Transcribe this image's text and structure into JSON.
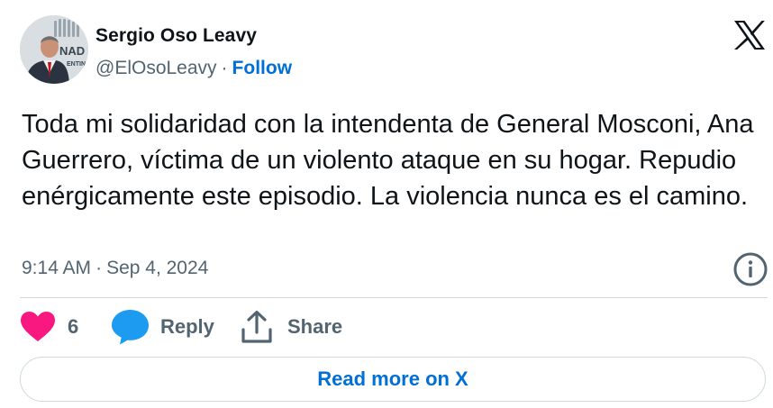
{
  "author": {
    "display_name": "Sergio Oso Leavy",
    "handle": "@ElOsoLeavy",
    "follow_label": "Follow",
    "avatar_backdrop_text_1": "NAD",
    "avatar_backdrop_text_2": "ENTIN"
  },
  "separator": "·",
  "tweet": {
    "text": "Toda mi solidaridad con la intendenta de General Mosconi, Ana Guerrero, víctima de un violento ataque en su hogar. Repudio enérgicamente este episodio. La violencia nunca es el camino.",
    "time": "9:14 AM",
    "date": "Sep 4, 2024"
  },
  "actions": {
    "like_count": "6",
    "reply_label": "Reply",
    "share_label": "Share"
  },
  "footer": {
    "read_more_label": "Read more on X"
  },
  "colors": {
    "link_blue": "#006fd6",
    "like_pink": "#f91880",
    "reply_blue": "#1d9bf0",
    "muted_text": "#536471",
    "divider": "#cfd9de"
  },
  "icons": [
    "x-logo-icon",
    "info-icon",
    "heart-icon",
    "reply-bubble-icon",
    "share-icon"
  ]
}
